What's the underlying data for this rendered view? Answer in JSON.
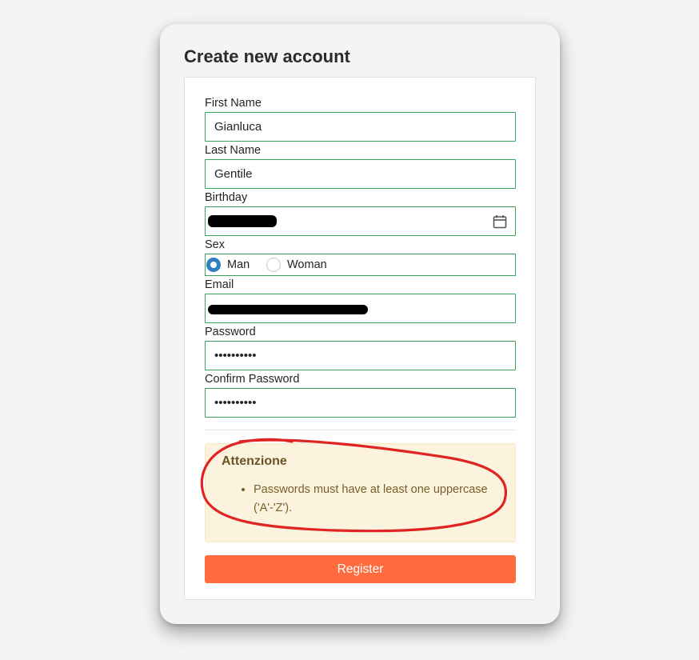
{
  "page": {
    "title": "Create new account"
  },
  "form": {
    "first_name": {
      "label": "First Name",
      "value": "Gianluca"
    },
    "last_name": {
      "label": "Last Name",
      "value": "Gentile"
    },
    "birthday": {
      "label": "Birthday",
      "value": ""
    },
    "sex": {
      "label": "Sex",
      "options": [
        {
          "label": "Man",
          "checked": true
        },
        {
          "label": "Woman",
          "checked": false
        }
      ]
    },
    "email": {
      "label": "Email",
      "value": ""
    },
    "password": {
      "label": "Password",
      "value": "••••••••••"
    },
    "confirm_password": {
      "label": "Confirm Password",
      "value": "••••••••••"
    }
  },
  "alert": {
    "title": "Attenzione",
    "messages": [
      "Passwords must have at least one uppercase ('A'-'Z')."
    ]
  },
  "actions": {
    "register_label": "Register"
  },
  "colors": {
    "input_border": "#3aa55a",
    "radio_checked": "#2f7fc1",
    "alert_bg": "#fbf3dd",
    "alert_text": "#77602a",
    "button_bg": "#ff6b3d",
    "annotation_stroke": "#e02424"
  },
  "icons": {
    "birthday_picker": "calendar-icon"
  }
}
